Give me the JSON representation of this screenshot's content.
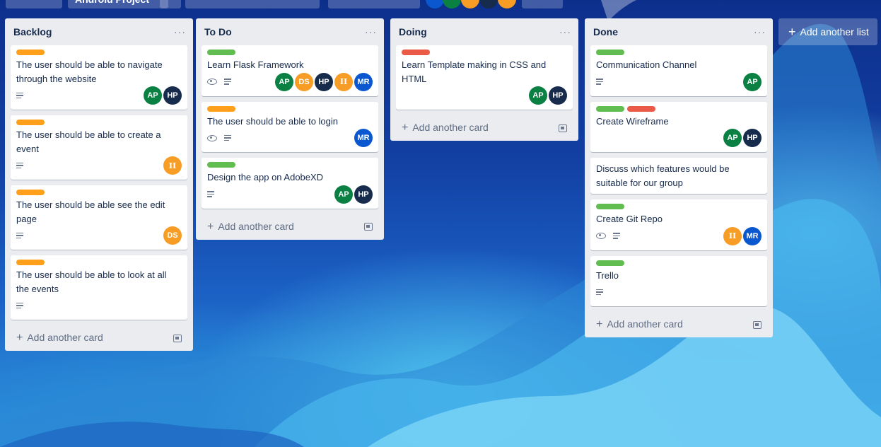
{
  "colors": {
    "orange": "#ff9f1a",
    "green": "#61bd4f",
    "red": "#eb5a46",
    "av_green": "#0b8043",
    "av_navy": "#172b4d",
    "av_orange": "#f79c24",
    "av_blue": "#0b57d0"
  },
  "top_bar": {
    "board_title": "Android Project"
  },
  "lists": [
    {
      "title": "Backlog",
      "menu": "···",
      "add_card": "Add another card",
      "cards": [
        {
          "title": "The user should be able to navigate through the website",
          "labels": [
            "orange"
          ],
          "watch": false,
          "desc": true,
          "members": [
            "AP",
            "HP"
          ]
        },
        {
          "title": "The user should be able to create a event",
          "labels": [
            "orange"
          ],
          "watch": false,
          "desc": true,
          "members": [
            "II"
          ]
        },
        {
          "title": "The user should be able see the edit page",
          "labels": [
            "orange"
          ],
          "watch": false,
          "desc": true,
          "members": [
            "DS"
          ]
        },
        {
          "title": "The user should be able to look at all the events",
          "labels": [
            "orange"
          ],
          "watch": false,
          "desc": true,
          "members": []
        }
      ]
    },
    {
      "title": "To Do",
      "menu": "···",
      "add_card": "Add another card",
      "cards": [
        {
          "title": "Learn Flask Framework",
          "labels": [
            "green"
          ],
          "watch": true,
          "desc": true,
          "members": [
            "AP",
            "DS",
            "HP",
            "II",
            "MR"
          ]
        },
        {
          "title": "The user should be able to login",
          "labels": [
            "orange"
          ],
          "watch": true,
          "desc": true,
          "members": [
            "MR"
          ]
        },
        {
          "title": "Design the app on AdobeXD",
          "labels": [
            "green"
          ],
          "watch": false,
          "desc": true,
          "members": [
            "AP",
            "HP"
          ]
        }
      ]
    },
    {
      "title": "Doing",
      "menu": "···",
      "add_card": "Add another card",
      "cards": [
        {
          "title": "Learn Template making in CSS and HTML",
          "labels": [
            "red"
          ],
          "watch": false,
          "desc": false,
          "members": [
            "AP",
            "HP"
          ]
        }
      ]
    },
    {
      "title": "Done",
      "menu": "···",
      "add_card": "Add another card",
      "cards": [
        {
          "title": "Communication Channel",
          "labels": [
            "green"
          ],
          "watch": false,
          "desc": true,
          "members": [
            "AP"
          ]
        },
        {
          "title": "Create Wireframe",
          "labels": [
            "green",
            "red"
          ],
          "watch": false,
          "desc": false,
          "members": [
            "AP",
            "HP"
          ]
        },
        {
          "title": "Discuss which features would be suitable for our group",
          "labels": [],
          "watch": false,
          "desc": false,
          "members": []
        },
        {
          "title": "Create Git Repo",
          "labels": [
            "green"
          ],
          "watch": true,
          "desc": true,
          "members": [
            "II",
            "MR"
          ]
        },
        {
          "title": "Trello",
          "labels": [
            "green"
          ],
          "watch": false,
          "desc": true,
          "members": []
        }
      ]
    }
  ],
  "add_list": "Add another list",
  "icons": {
    "plus": "plus-icon",
    "watch": "eye-icon",
    "description": "description-icon",
    "template": "card-template-icon",
    "menu": "more-horizontal-icon"
  }
}
